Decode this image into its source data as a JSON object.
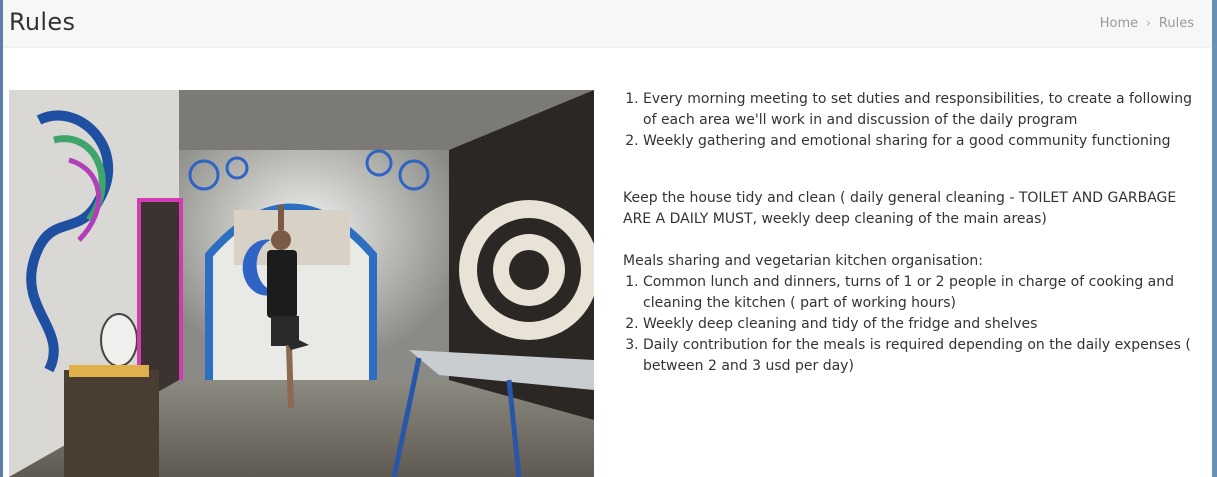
{
  "page": {
    "title": "Rules",
    "breadcrumb": {
      "home": "Home",
      "separator": "›",
      "current": "Rules"
    }
  },
  "image": {
    "description_icon": "photo-yoga-tree-pose"
  },
  "rules": {
    "meetings": [
      "Every morning meeting to set duties and responsibilities, to create a following of each area we'll work in and discussion of the daily program",
      "Weekly gathering and emotional sharing for a good community functioning"
    ],
    "house_paragraph": "Keep the house tidy and clean ( daily general cleaning - TOILET AND GARBAGE ARE A DAILY MUST, weekly deep cleaning of the main areas)",
    "meals_heading": "Meals sharing and vegetarian kitchen organisation:",
    "meals": [
      "Common lunch and dinners, turns of 1 or 2 people in charge of cooking and cleaning the kitchen ( part of working hours)",
      "Weekly deep cleaning and tidy of the fridge and shelves",
      "Daily contribution for the meals is required depending on the daily expenses ( between 2 and 3 usd per day)"
    ]
  },
  "colors": {
    "header_bg": "#f7f7f7",
    "text": "#333333",
    "breadcrumb": "#999999",
    "frame": "#5a7fa8"
  }
}
